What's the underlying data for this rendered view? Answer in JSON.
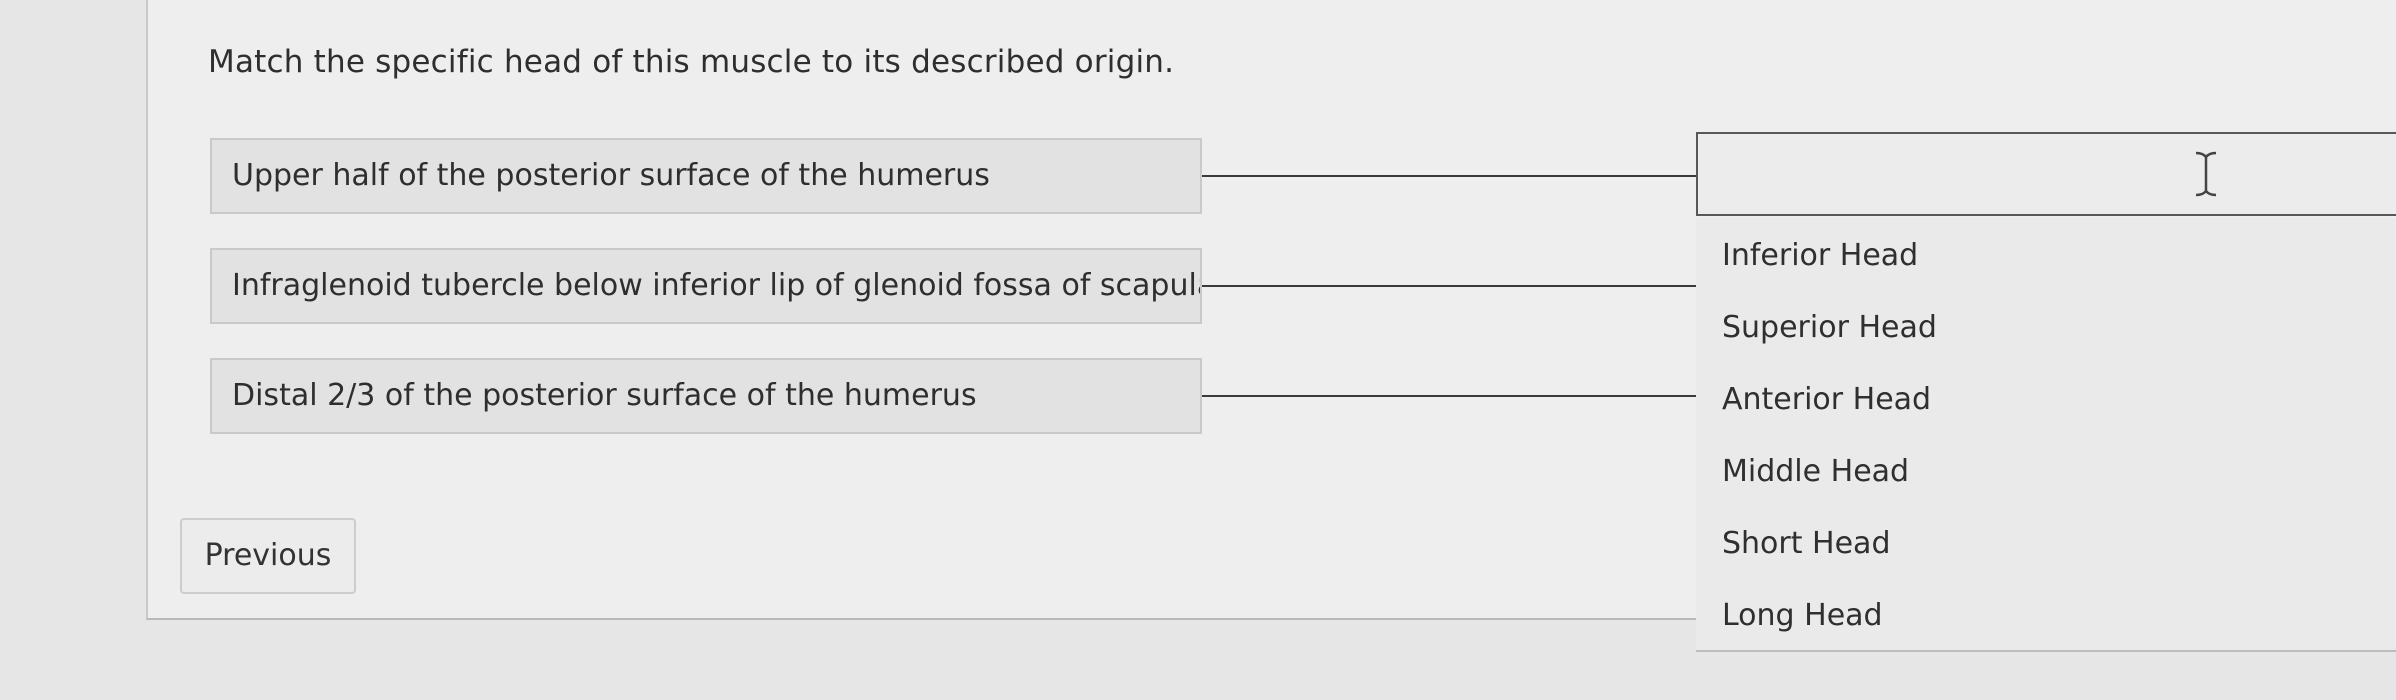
{
  "question": {
    "text": "Match the specific head of this muscle to its described origin."
  },
  "prompts": [
    {
      "text": "Upper half of the posterior surface of the humerus"
    },
    {
      "text": "Infraglenoid tubercle below inferior lip of glenoid fossa of scapula"
    },
    {
      "text": "Distal 2/3 of the posterior surface of the humerus"
    }
  ],
  "dropdown": {
    "selected": "",
    "options": [
      "Inferior Head",
      "Superior Head",
      "Anterior Head",
      "Middle Head",
      "Short Head",
      "Long Head"
    ]
  },
  "nav": {
    "previous_label": "Previous"
  },
  "icons": {
    "cursor": "text-cursor-icon"
  },
  "colors": {
    "page_bg": "#e6e6e6",
    "card_bg": "#eeeeee",
    "prompt_bg": "#e2e2e2",
    "select_border": "#585858"
  }
}
